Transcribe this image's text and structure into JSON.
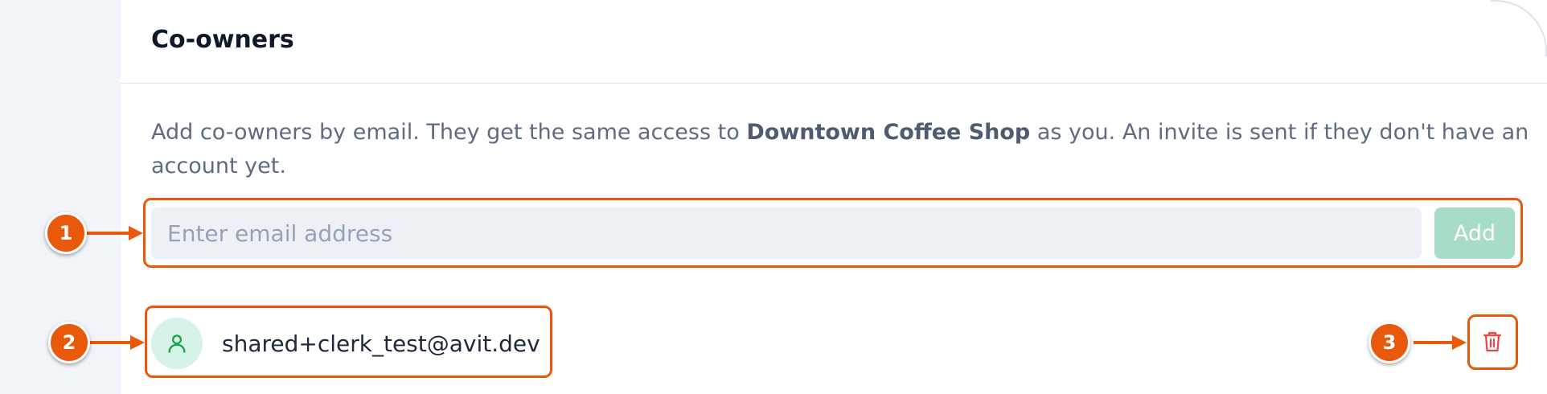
{
  "card": {
    "title": "Co-owners",
    "description_prefix": "Add co-owners by email. They get the same access to ",
    "business_name": "Downtown Coffee Shop",
    "description_suffix": " as you. An invite is sent if they don't have an account yet."
  },
  "invite_form": {
    "email_placeholder": "Enter email address",
    "email_value": "",
    "add_label": "Add"
  },
  "co_owners": [
    {
      "email": "shared+clerk_test@avit.dev",
      "avatar_icon": "user-icon",
      "remove_icon": "trash-icon"
    }
  ],
  "callouts": [
    "1",
    "2",
    "3"
  ],
  "colors": {
    "accent": "#e8590c",
    "add_button_disabled": "#a7dcc6",
    "avatar_bg": "#d5f4e7",
    "avatar_icon": "#16a34a",
    "delete_icon": "#ef4444",
    "sidebar_bg": "#f1f4f9"
  }
}
